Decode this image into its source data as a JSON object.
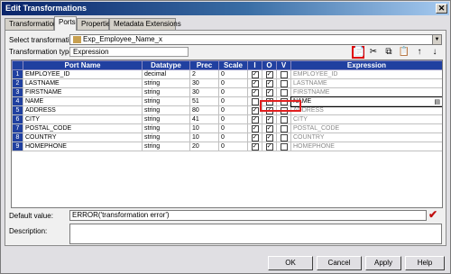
{
  "window": {
    "title": "Edit Transformations",
    "close": "✕"
  },
  "tabs": [
    "Transformation",
    "Ports",
    "Properties",
    "Metadata Extensions"
  ],
  "active_tab": "Ports",
  "select_label": "Select transformation:",
  "select_value": "Exp_Employee_Name_x",
  "type_label": "Transformation type:",
  "type_value": "Expression",
  "toolbar": {
    "new_port": "📄",
    "cut": "✂",
    "copy": "⧉",
    "paste": "📋",
    "move_up": "↑",
    "move_down": "↓"
  },
  "columns": [
    "Port Name",
    "Datatype",
    "Prec",
    "Scale",
    "I",
    "O",
    "V",
    "Expression"
  ],
  "rows": [
    {
      "num": "1",
      "name": "EMPLOYEE_ID",
      "type": "decimal",
      "prec": "2",
      "scale": "0",
      "i": "✓",
      "o": "✓",
      "v": "",
      "expr": "EMPLOYEE_ID"
    },
    {
      "num": "2",
      "name": "LASTNAME",
      "type": "string",
      "prec": "30",
      "scale": "0",
      "i": "✓",
      "o": "✓",
      "v": "",
      "expr": "LASTNAME"
    },
    {
      "num": "3",
      "name": "FIRSTNAME",
      "type": "string",
      "prec": "30",
      "scale": "0",
      "i": "✓",
      "o": "✓",
      "v": "",
      "expr": "FIRSTNAME"
    },
    {
      "num": "4",
      "name": "NAME",
      "type": "string",
      "prec": "51",
      "scale": "0",
      "i": "",
      "o": "✓",
      "v": "",
      "expr": "NAME"
    },
    {
      "num": "5",
      "name": "ADDRESS",
      "type": "string",
      "prec": "80",
      "scale": "0",
      "i": "✓",
      "o": "✓",
      "v": "",
      "expr": "ADDRESS"
    },
    {
      "num": "6",
      "name": "CITY",
      "type": "string",
      "prec": "41",
      "scale": "0",
      "i": "✓",
      "o": "✓",
      "v": "",
      "expr": "CITY"
    },
    {
      "num": "7",
      "name": "POSTAL_CODE",
      "type": "string",
      "prec": "10",
      "scale": "0",
      "i": "✓",
      "o": "✓",
      "v": "",
      "expr": "POSTAL_CODE"
    },
    {
      "num": "8",
      "name": "COUNTRY",
      "type": "string",
      "prec": "10",
      "scale": "0",
      "i": "✓",
      "o": "✓",
      "v": "",
      "expr": "COUNTRY"
    },
    {
      "num": "9",
      "name": "HOMEPHONE",
      "type": "string",
      "prec": "20",
      "scale": "0",
      "i": "✓",
      "o": "✓",
      "v": "",
      "expr": "HOMEPHONE"
    }
  ],
  "default_label": "Default value:",
  "default_value": "ERROR('transformation error')",
  "description_label": "Description:",
  "description_value": "",
  "buttons": {
    "ok": "OK",
    "cancel": "Cancel",
    "apply": "Apply",
    "help": "Help"
  }
}
